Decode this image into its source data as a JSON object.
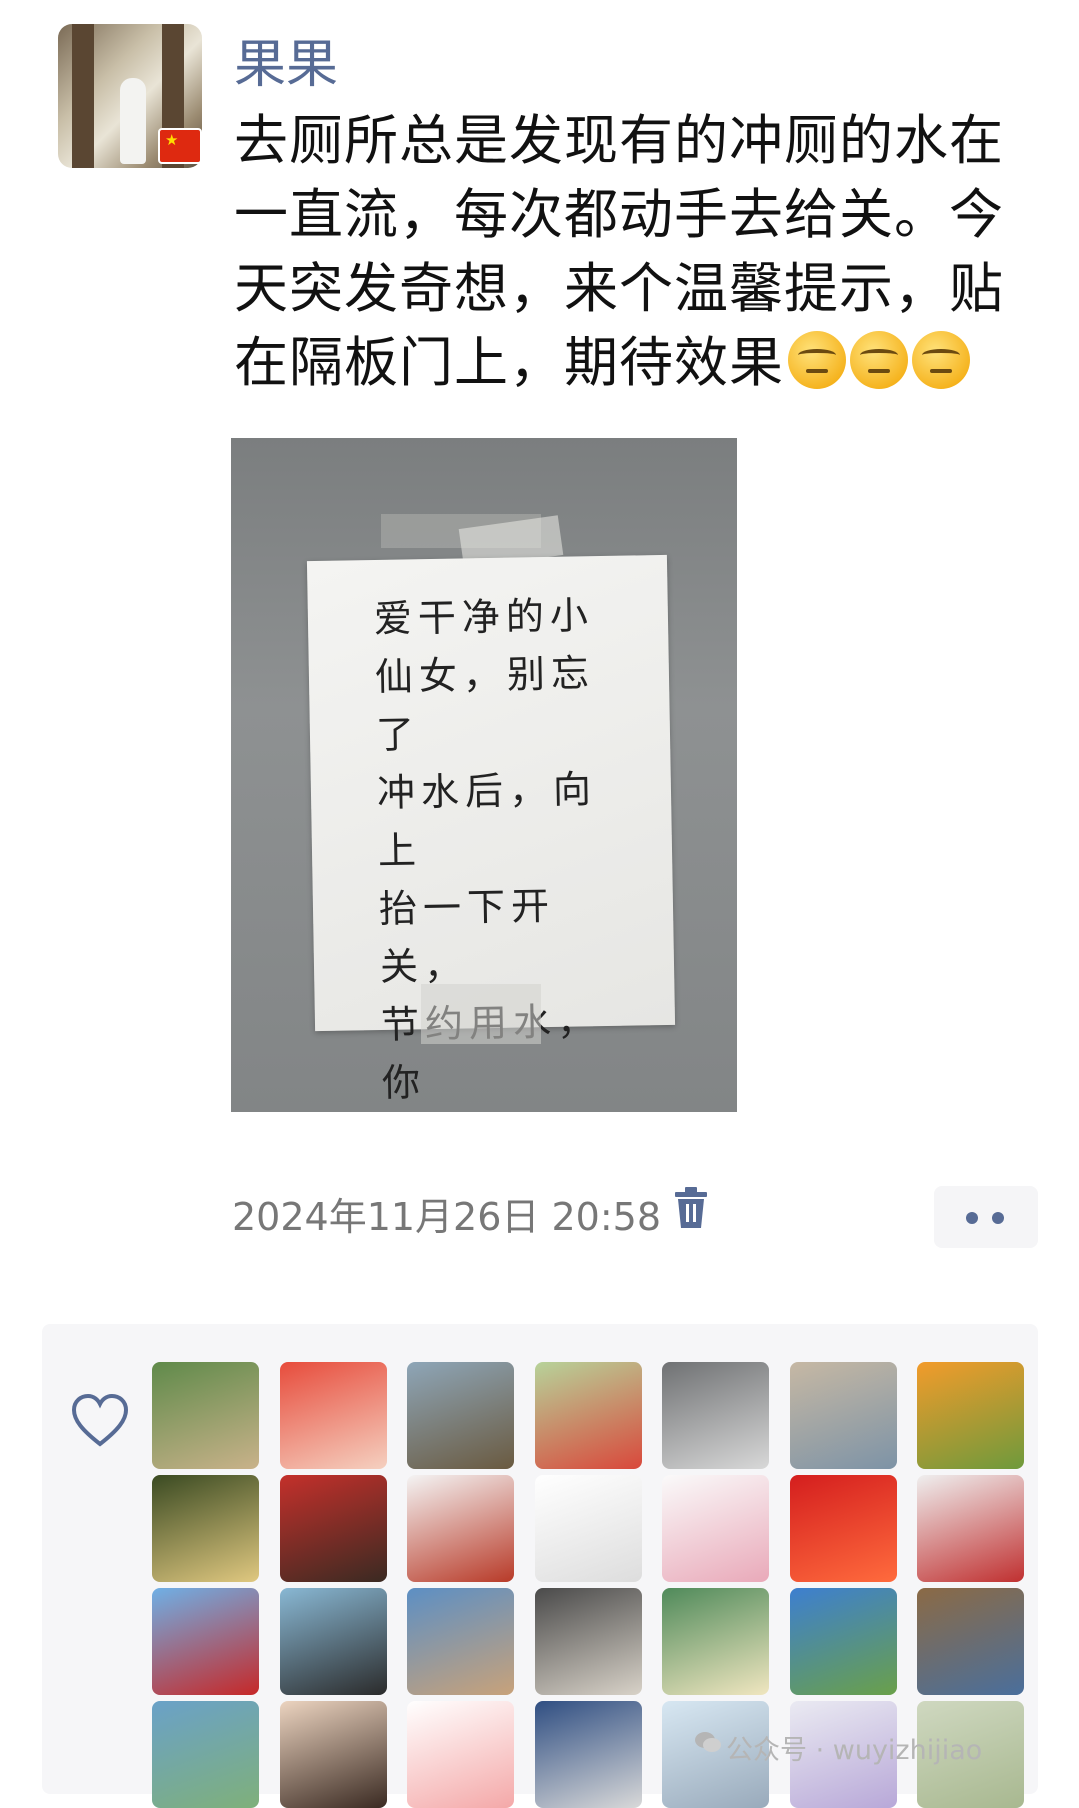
{
  "post": {
    "username": "果果",
    "text_line1": "去厕所总是发现有的冲厕的水在",
    "text_line2": "一直流，每次都动手去给关。今",
    "text_line3": "天突发奇想，来个温馨提示，贴",
    "text_line4": "在隔板门上，期待效果",
    "emoji_name": "smirk-emoji",
    "note_text": "爱干净的小\n仙女，别忘了\n冲水后，向上\n抬一下开关，\n节约用水，你\n最美!!!",
    "timestamp": "2024年11月26日 20:58"
  },
  "colors": {
    "username": "#576b95",
    "timestamp": "#777777",
    "panel_bg": "#f6f6f8"
  },
  "likes": {
    "icon": "heart-outline-icon",
    "avatars": [
      {
        "colors": [
          "#5f8a4a",
          "#c9b28a"
        ]
      },
      {
        "colors": [
          "#e74c3c",
          "#f5d0c0"
        ]
      },
      {
        "colors": [
          "#8ea6b8",
          "#6a5a40"
        ]
      },
      {
        "colors": [
          "#b7d39a",
          "#d9483b"
        ]
      },
      {
        "colors": [
          "#6f7173",
          "#d8d8d8"
        ]
      },
      {
        "colors": [
          "#c6b8a4",
          "#7d93a6"
        ]
      },
      {
        "colors": [
          "#f29b2b",
          "#6e9a3c"
        ]
      },
      {
        "colors": [
          "#3a4a22",
          "#e0c880"
        ]
      },
      {
        "colors": [
          "#c4302b",
          "#3a2a22"
        ]
      },
      {
        "colors": [
          "#f4f4f4",
          "#b83a28"
        ]
      },
      {
        "colors": [
          "#ffffff",
          "#dddddd"
        ]
      },
      {
        "colors": [
          "#fafafa",
          "#e9a9b9"
        ]
      },
      {
        "colors": [
          "#d41e1e",
          "#ff6b3d"
        ]
      },
      {
        "colors": [
          "#efefef",
          "#c03030"
        ]
      },
      {
        "colors": [
          "#6fb0e6",
          "#c62828"
        ]
      },
      {
        "colors": [
          "#89b8d4",
          "#2b2b2b"
        ]
      },
      {
        "colors": [
          "#5c8fc4",
          "#c8a27a"
        ]
      },
      {
        "colors": [
          "#4a4a4a",
          "#d8d2c8"
        ]
      },
      {
        "colors": [
          "#4f8a5a",
          "#f0e6c0"
        ]
      },
      {
        "colors": [
          "#3d7fd0",
          "#6aa04a"
        ]
      },
      {
        "colors": [
          "#8b6a45",
          "#4a6f9c"
        ]
      },
      {
        "colors": [
          "#6aa1c8",
          "#7fb07a"
        ]
      },
      {
        "colors": [
          "#ecd4c0",
          "#3a2a22"
        ]
      },
      {
        "colors": [
          "#ffffff",
          "#f4a8a8"
        ]
      },
      {
        "colors": [
          "#2f4e82",
          "#d9d9d9"
        ]
      },
      {
        "colors": [
          "#d7e7f2",
          "#9ab"
        ]
      },
      {
        "colors": [
          "#eaeaf2",
          "#b8a8d8"
        ]
      },
      {
        "colors": [
          "#cfd8c0",
          "#a8b890"
        ]
      }
    ]
  },
  "watermark": {
    "text": "公众号 · wuyizhijiao",
    "icon": "wechat-icon"
  }
}
